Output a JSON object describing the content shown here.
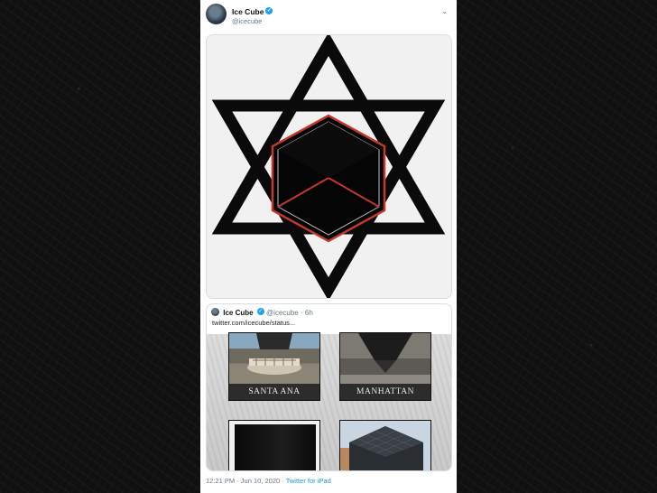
{
  "tweet": {
    "author": {
      "name": "Ice Cube",
      "handle": "@icecube",
      "verified": true
    },
    "menu_icon": "chevron-down-icon",
    "media": {
      "description_icon": "star-of-david-cube-image"
    },
    "quoted": {
      "name": "Ice Cube",
      "handle": "@icecube",
      "age": "6h",
      "separator": "·",
      "link": "twitter.com/icecube/status...",
      "panels": [
        "SANTA ANA",
        "MANHATTAN"
      ]
    },
    "footer": {
      "time": "12:21 PM",
      "separator": "·",
      "date": "Jun 10, 2020",
      "separator2": "·",
      "source": "Twitter for iPad"
    }
  },
  "colors": {
    "verified": "#1da1f2",
    "link": "#1b95e0",
    "cube_outline": "#c0392b"
  }
}
